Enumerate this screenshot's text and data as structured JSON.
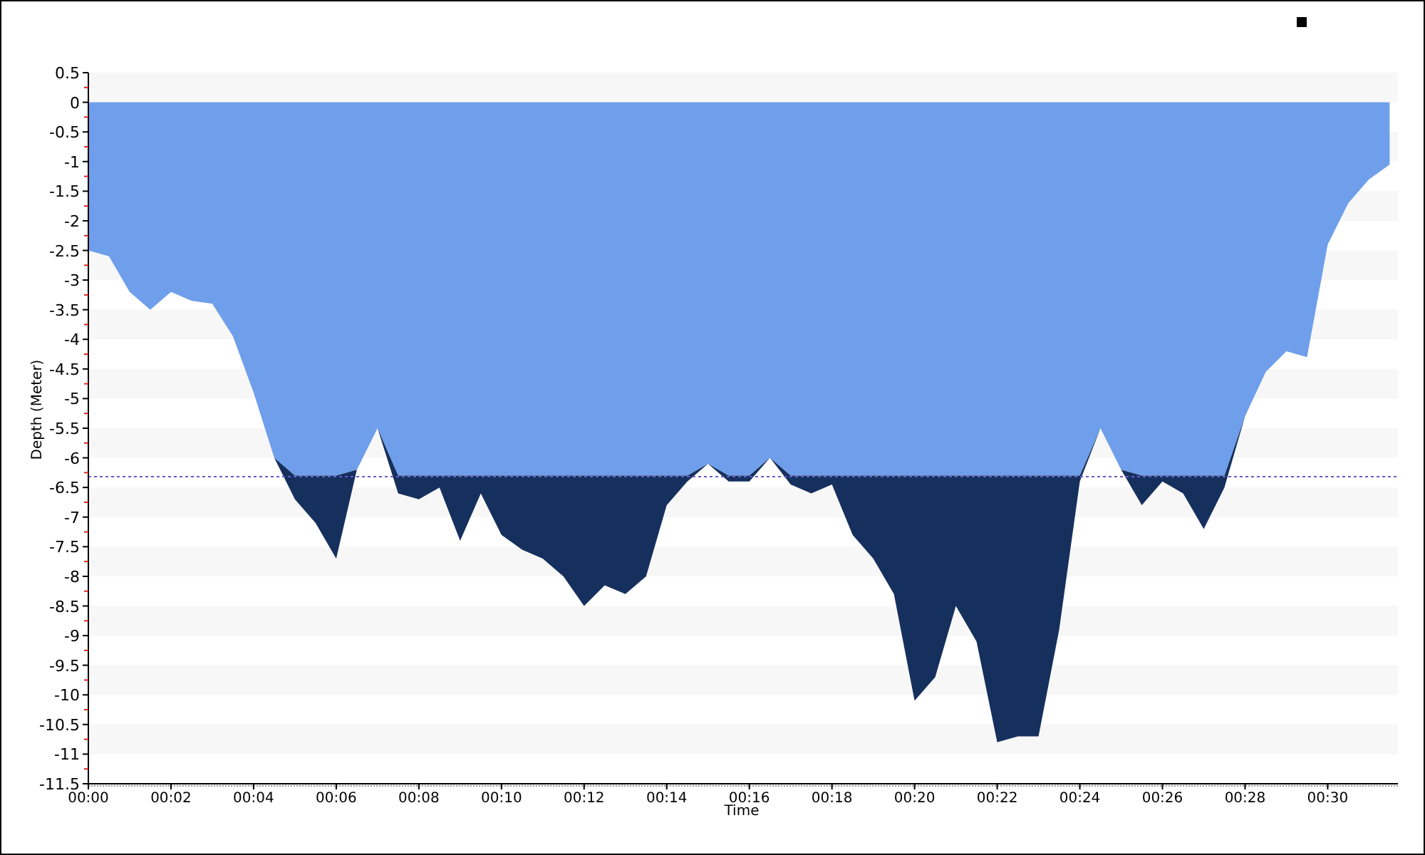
{
  "chart": {
    "chart_data": {
      "type": "area",
      "xlabel": "Time",
      "ylabel": "Depth (Meter)",
      "stacked": true,
      "x": [
        0,
        0.5,
        1,
        1.5,
        2,
        2.5,
        3,
        3.5,
        4,
        4.5,
        5,
        5.5,
        6,
        6.5,
        7,
        7.5,
        8,
        8.5,
        9,
        9.5,
        10,
        10.5,
        11,
        11.5,
        12,
        12.5,
        13,
        13.5,
        14,
        14.5,
        15,
        15.5,
        16,
        16.5,
        17,
        17.5,
        18,
        18.5,
        19,
        19.5,
        20,
        20.5,
        21,
        21.5,
        22,
        22.5,
        23,
        23.5,
        24,
        24.5,
        25,
        25.5,
        26,
        26.5,
        27,
        27.5,
        28,
        28.5,
        29,
        29.5,
        30,
        30.5,
        31,
        31.5
      ],
      "series": [
        {
          "color": "#6f9fea",
          "values": [
            -2.5,
            -2.6,
            -3.2,
            -3.5,
            -3.2,
            -3.35,
            -3.4,
            -3.95,
            -4.9,
            -6.0,
            -6.3,
            -6.3,
            -6.3,
            -6.2,
            -5.5,
            -6.3,
            -6.3,
            -6.3,
            -6.3,
            -6.3,
            -6.3,
            -6.3,
            -6.3,
            -6.3,
            -6.3,
            -6.3,
            -6.3,
            -6.3,
            -6.3,
            -6.3,
            -6.1,
            -6.3,
            -6.3,
            -6.0,
            -6.3,
            -6.3,
            -6.3,
            -6.3,
            -6.3,
            -6.3,
            -6.3,
            -6.3,
            -6.3,
            -6.3,
            -6.3,
            -6.3,
            -6.3,
            -6.3,
            -6.3,
            -5.5,
            -6.2,
            -6.3,
            -6.3,
            -6.3,
            -6.3,
            -6.3,
            -5.3,
            -4.55,
            -4.2,
            -4.3,
            -2.4,
            -1.7,
            -1.3,
            -1.05
          ]
        },
        {
          "color": "#16305e",
          "values": [
            0,
            0,
            0,
            0,
            0,
            0,
            0,
            0,
            0,
            0,
            -0.4,
            -0.8,
            -1.4,
            0,
            0,
            -0.3,
            -0.4,
            -0.2,
            -1.1,
            -0.3,
            -1.0,
            -1.25,
            -1.4,
            -1.7,
            -2.2,
            -1.85,
            -2.0,
            -1.7,
            -0.5,
            -0.1,
            0,
            -0.1,
            -0.1,
            0,
            -0.15,
            -0.3,
            -0.15,
            -1.0,
            -1.4,
            -2.0,
            -3.8,
            -3.4,
            -2.2,
            -2.8,
            -4.5,
            -4.4,
            -4.4,
            -2.6,
            -0.1,
            0,
            0,
            -0.5,
            -0.1,
            -0.3,
            -0.9,
            -0.2,
            0,
            0,
            0,
            0,
            0,
            0,
            0,
            0
          ]
        }
      ],
      "xlim": [
        0,
        31.7
      ],
      "ylim": [
        -11.5,
        0.5
      ],
      "xticks": [
        {
          "value": 0,
          "label": "00:00"
        },
        {
          "value": 2,
          "label": "00:02"
        },
        {
          "value": 4,
          "label": "00:04"
        },
        {
          "value": 6,
          "label": "00:06"
        },
        {
          "value": 8,
          "label": "00:08"
        },
        {
          "value": 10,
          "label": "00:10"
        },
        {
          "value": 12,
          "label": "00:12"
        },
        {
          "value": 14,
          "label": "00:14"
        },
        {
          "value": 16,
          "label": "00:16"
        },
        {
          "value": 18,
          "label": "00:18"
        },
        {
          "value": 20,
          "label": "00:20"
        },
        {
          "value": 22,
          "label": "00:22"
        },
        {
          "value": 24,
          "label": "00:24"
        },
        {
          "value": 26,
          "label": "00:26"
        },
        {
          "value": 28,
          "label": "00:28"
        },
        {
          "value": 30,
          "label": "00:30"
        }
      ],
      "yticks": [
        0.5,
        0,
        -0.5,
        -1,
        -1.5,
        -2,
        -2.5,
        -3,
        -3.5,
        -4,
        -4.5,
        -5,
        -5.5,
        -6,
        -6.5,
        -7,
        -7.5,
        -8,
        -8.5,
        -9,
        -9.5,
        -10,
        -10.5,
        -11,
        -11.5
      ],
      "ref_lines": [
        {
          "axis": "y",
          "value": -6.3
        }
      ]
    }
  }
}
